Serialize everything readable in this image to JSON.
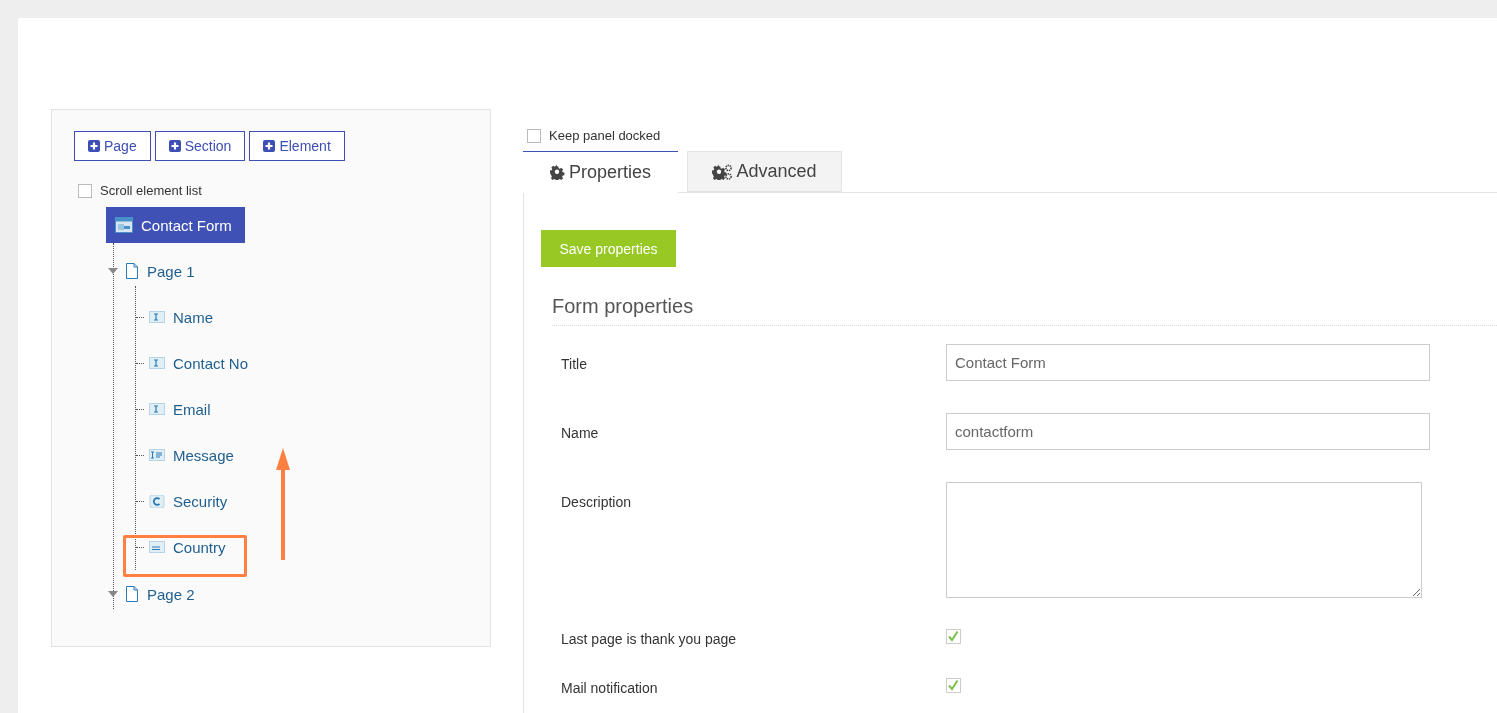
{
  "toolbar": {
    "buttons": [
      {
        "label": "Page"
      },
      {
        "label": "Section"
      },
      {
        "label": "Element"
      }
    ]
  },
  "scroll_option": {
    "label": "Scroll element list",
    "checked": false
  },
  "tree": {
    "label": "Contact Form",
    "selected": true,
    "children": [
      {
        "label": "Page 1",
        "expanded": true,
        "children": [
          {
            "label": "Name",
            "kind": "text"
          },
          {
            "label": "Contact No",
            "kind": "text"
          },
          {
            "label": "Email",
            "kind": "text"
          },
          {
            "label": "Message",
            "kind": "textarea"
          },
          {
            "label": "Security",
            "kind": "captcha"
          },
          {
            "label": "Country",
            "kind": "dropdown"
          }
        ]
      },
      {
        "label": "Page 2",
        "expanded": true
      }
    ]
  },
  "dock_option": {
    "label": "Keep panel docked",
    "checked": false
  },
  "tabs": [
    {
      "label": "Properties",
      "selected": true,
      "kind": "gear"
    },
    {
      "label": "Advanced",
      "selected": false,
      "kind": "gears"
    }
  ],
  "save_button": "Save properties",
  "section_title": "Form properties",
  "fields": [
    {
      "label": "Title",
      "kind": "input",
      "value": "Contact Form"
    },
    {
      "label": "Name",
      "kind": "input",
      "value": "contactform"
    },
    {
      "label": "Description",
      "kind": "textarea"
    },
    {
      "label": "Last page is thank you page",
      "kind": "checkbox",
      "checked": true
    },
    {
      "label": "Mail notification",
      "kind": "checkbox",
      "checked": true
    }
  ]
}
